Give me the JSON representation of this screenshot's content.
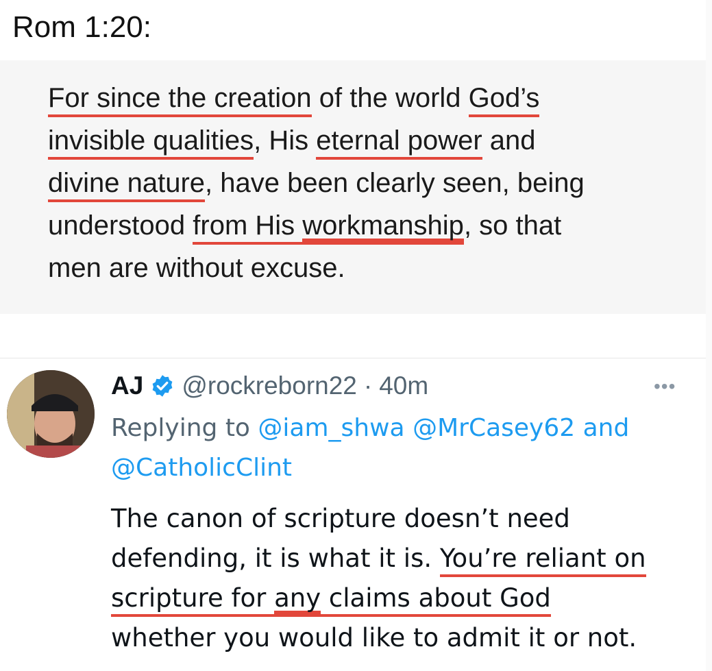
{
  "heading": "Rom 1:20:",
  "verse": {
    "line1": {
      "a": "For since the creation",
      "b": " of the world ",
      "c": "God’s"
    },
    "line2": {
      "a": "invisible qualities",
      "b": ", His ",
      "c": "eternal power",
      "d": " and"
    },
    "line3": {
      "a": "divine nature",
      "b": ", have been clearly seen, being"
    },
    "line4": {
      "a": "understood ",
      "b": "from His ",
      "c": "workmanship",
      "d": ", so that"
    },
    "line5": {
      "a": "men are without excuse."
    }
  },
  "highlight_color": "#e2473b",
  "tweet": {
    "display_name": "AJ",
    "verified_icon": "verified-badge-icon",
    "handle": "@rockreborn22",
    "separator": "·",
    "time": "40m",
    "more_icon": "•••",
    "replying_prefix": "Replying to ",
    "mention1": "@iam_shwa",
    "mention2": "@MrCasey62",
    "and_text": " and",
    "mention3": "@CatholicClint",
    "body": {
      "line1": "The canon of scripture doesn’t need",
      "line2a": "defending, it is what it is. ",
      "line2b": "You’re reliant on",
      "line3a": "scripture for ",
      "line3b": "any",
      "line3c": " claims about God",
      "line4": "whether you would like to admit it or not."
    },
    "link_color": "#1d9bf0",
    "muted_color": "#536471"
  }
}
